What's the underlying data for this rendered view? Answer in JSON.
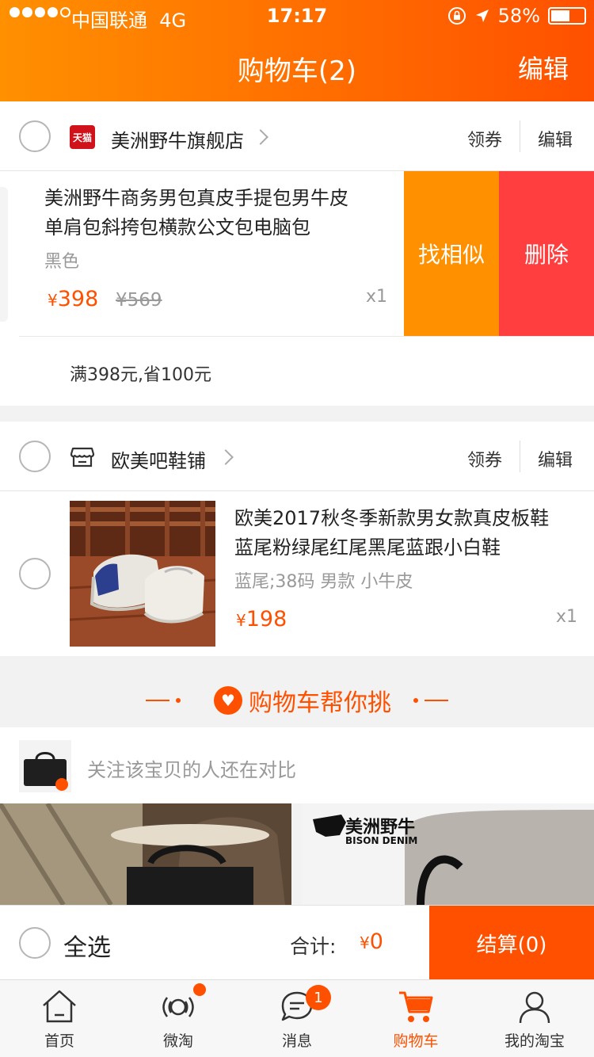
{
  "status": {
    "carrier": "中国联通",
    "network": "4G",
    "time": "17:17",
    "battery": "58%"
  },
  "header": {
    "title": "购物车(2)",
    "edit": "编辑"
  },
  "shops": [
    {
      "name": "美洲野牛旗舰店",
      "badge": "天猫",
      "coupon": "领券",
      "edit": "编辑",
      "item": {
        "title_line1": "美洲野牛商务男包真皮手提包男牛皮",
        "title_line2": "单肩包斜挎包横款公文包电脑包",
        "sku": "黑色",
        "currency": "¥",
        "price": "398",
        "old_price": "¥569",
        "qty": "x1",
        "find_similar": "找相似",
        "delete": "删除"
      },
      "promo": "满398元,省100元"
    },
    {
      "name": "欧美吧鞋铺",
      "coupon": "领券",
      "edit": "编辑",
      "item": {
        "title_line1": "欧美2017秋冬季新款男女款真皮板鞋",
        "title_line2": "蓝尾粉绿尾红尾黑尾蓝跟小白鞋",
        "sku": "蓝尾;38码 男款 小牛皮",
        "currency": "¥",
        "price": "198",
        "qty": "x1"
      }
    }
  ],
  "helper": {
    "title": "购物车帮你挑"
  },
  "compare": {
    "text": "关注该宝贝的人还在对比"
  },
  "ad": {
    "brand_cn": "美洲野牛",
    "brand_en": "BISON DENIM"
  },
  "bottom": {
    "select_all": "全选",
    "total_label": "合计:",
    "currency": "¥",
    "total": "0",
    "checkout": "结算(0)"
  },
  "tabs": [
    {
      "label": "首页",
      "icon": "home-icon"
    },
    {
      "label": "微淘",
      "icon": "broadcast-icon"
    },
    {
      "label": "消息",
      "icon": "message-icon",
      "badge": "1"
    },
    {
      "label": "购物车",
      "icon": "cart-icon",
      "active": true
    },
    {
      "label": "我的淘宝",
      "icon": "user-icon"
    }
  ],
  "colors": {
    "brand": "#ff5000",
    "accent": "#ff9000",
    "delete": "#ff3f3f"
  }
}
